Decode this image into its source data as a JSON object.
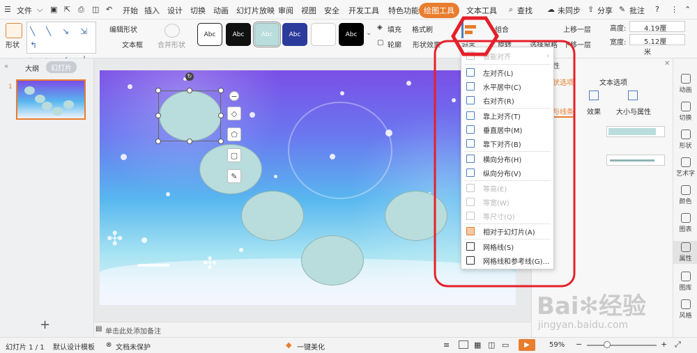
{
  "menubar": {
    "file": "文件",
    "items": [
      "开始",
      "插入",
      "设计",
      "切换",
      "动画",
      "幻灯片放映",
      "审阅",
      "视图",
      "安全",
      "开发工具",
      "特色功能"
    ],
    "drawing_tools": "绘图工具",
    "text_tools": "文本工具",
    "search": "查找",
    "sync": "未同步",
    "share": "分享",
    "annotate": "批注"
  },
  "ribbon": {
    "shape": "形状",
    "edit_shape": "编辑形状",
    "text_box": "文本框",
    "merge_shape": "合并形状",
    "style_labels": [
      "Abc",
      "Abc",
      "Abc",
      "Abc",
      "",
      "Abc"
    ],
    "fill": "填充",
    "format_painter": "格式刷",
    "outline": "轮廓",
    "shape_effect": "形状效果",
    "align": "对齐",
    "group": "组合",
    "rotate": "旋转",
    "select_pane": "选择窗格",
    "bring_forward": "上移一层",
    "send_backward": "下移一层",
    "height_label": "高度:",
    "height_value": "4.19厘米",
    "width_label": "宽度:",
    "width_value": "5.12厘米"
  },
  "left_panel": {
    "tab_outline": "大纲",
    "tab_slides": "幻灯片",
    "slide_number": "1"
  },
  "notes_placeholder": "单击此处添加备注",
  "align_menu": {
    "header": "智能对齐",
    "items": [
      {
        "label": "左对齐(L)",
        "enabled": true
      },
      {
        "label": "水平居中(C)",
        "enabled": true
      },
      {
        "label": "右对齐(R)",
        "enabled": true
      },
      {
        "label": "靠上对齐(T)",
        "enabled": true
      },
      {
        "label": "垂直居中(M)",
        "enabled": true
      },
      {
        "label": "靠下对齐(B)",
        "enabled": true
      },
      {
        "label": "横向分布(H)",
        "enabled": true
      },
      {
        "label": "纵向分布(V)",
        "enabled": true
      },
      {
        "label": "等高(E)",
        "enabled": false
      },
      {
        "label": "等宽(W)",
        "enabled": false
      },
      {
        "label": "等尺寸(Q)",
        "enabled": false
      },
      {
        "label": "相对于幻灯片(A)",
        "enabled": true
      },
      {
        "label": "网格线(S)",
        "enabled": true
      },
      {
        "label": "网格线和参考线(G)...",
        "enabled": true
      }
    ]
  },
  "props_panel": {
    "title_suffix": "性",
    "tab_shape": "状选项",
    "tab_text": "文本选项",
    "sub_line": "与线条",
    "sub_effect": "效果",
    "sub_size": "大小与属性"
  },
  "right_rail": [
    "动画",
    "切换",
    "形状",
    "艺术字",
    "颜色",
    "图表",
    "属性",
    "图库",
    "风格"
  ],
  "statusbar": {
    "slide_info": "幻灯片 1 / 1",
    "template": "默认设计模板",
    "doc_protect": "文档未保护",
    "beautify": "一键美化",
    "zoom": "59%"
  },
  "watermark": {
    "brand": "Bai",
    "brand2": "经验",
    "url": "jingyan.baidu.com"
  },
  "colors": {
    "accent_orange": "#e87d2e",
    "highlight_red": "#e5202a",
    "shape_fill": "#b9dcdc"
  }
}
